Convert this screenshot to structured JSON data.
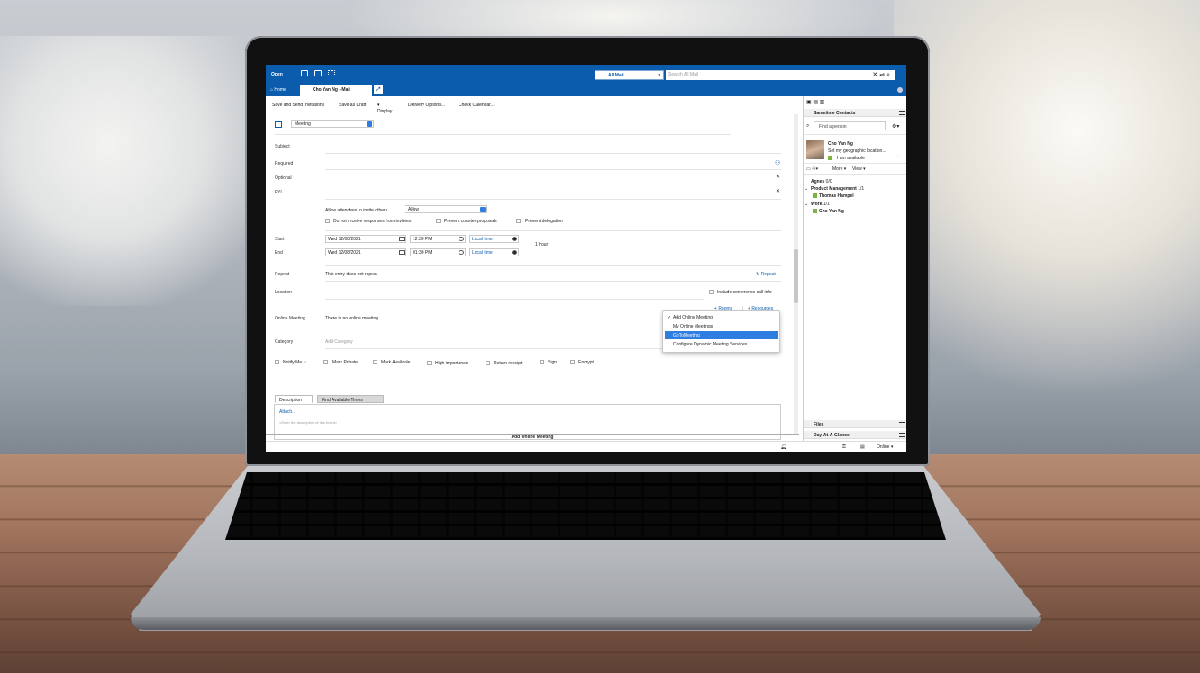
{
  "app": {
    "open_label": "Open",
    "mail_scope": "All Mail",
    "search_placeholder": "Search All Mail",
    "tabs": {
      "home": "Home",
      "mail": "Cho Yan Ng - Mail"
    }
  },
  "toolbar": {
    "save_send": "Save and Send Invitations",
    "save_draft": "Save as Draft",
    "display": "Display",
    "delivery": "Delivery Options...",
    "check_calendar": "Check Calendar..."
  },
  "form": {
    "type": "Meeting",
    "subject_label": "Subject",
    "required_label": "Required",
    "optional_label": "Optional",
    "fyi_label": "FYI",
    "allow_invite_label": "Allow attendees to invite others",
    "allow_value": "Allow",
    "no_responses": "Do not receive responses from invitees",
    "prevent_counter": "Prevent counter-proposals",
    "prevent_delegation": "Prevent delegation",
    "start_label": "Start",
    "end_label": "End",
    "start_date": "Wed 12/08/2021",
    "start_time": "12:30 PM",
    "end_date": "Wed 12/08/2021",
    "end_time": "01:30 PM",
    "timezone": "Local time",
    "duration": "1 hour",
    "repeat_label": "Repeat",
    "repeat_value": "This entry does not repeat",
    "repeat_link": "Repeat",
    "location_label": "Location",
    "conference_label": "Include conference call info",
    "rooms": "Rooms",
    "resources": "Resources",
    "online_label": "Online Meeting",
    "online_value": "There is no online meeting",
    "category_label": "Category",
    "category_placeholder": "Add Category",
    "notify_me": "Notify Me",
    "mark_private": "Mark Private",
    "mark_available": "Mark Available",
    "high_importance": "High importance",
    "return_receipt": "Return receipt",
    "sign": "Sign",
    "encrypt": "Encrypt",
    "tab_description": "Description",
    "tab_find_times": "Find Available Times",
    "attach": "Attach...",
    "description_placeholder": "<Enter the description of this event>"
  },
  "online_menu": {
    "items": [
      "Add Online Meeting",
      "My Online Meetings",
      "GoToMeeting",
      "Configure Dynamic Meeting Services"
    ],
    "selected": "GoToMeeting"
  },
  "status": {
    "center_text": "Add Online Meeting",
    "online": "Online"
  },
  "sametime": {
    "title": "Sametime Contacts",
    "find": "Find a person",
    "user_name": "Cho Yan Ng",
    "user_location": "Set my geographic location...",
    "user_status": "I am available",
    "more": "More",
    "view": "View",
    "groups": [
      {
        "name": "Agnes",
        "count": "0/0",
        "members": []
      },
      {
        "name": "Product Management",
        "count": "1/1",
        "members": [
          "Thomas Hampel"
        ]
      },
      {
        "name": "Work",
        "count": "1/1",
        "members": [
          "Cho Yan Ng"
        ]
      }
    ],
    "files": "Files",
    "day_at_a_glance": "Day-At-A-Glance"
  },
  "colors": {
    "brand": "#0b5cad",
    "accent": "#2e7de0",
    "available": "#7cb342"
  }
}
